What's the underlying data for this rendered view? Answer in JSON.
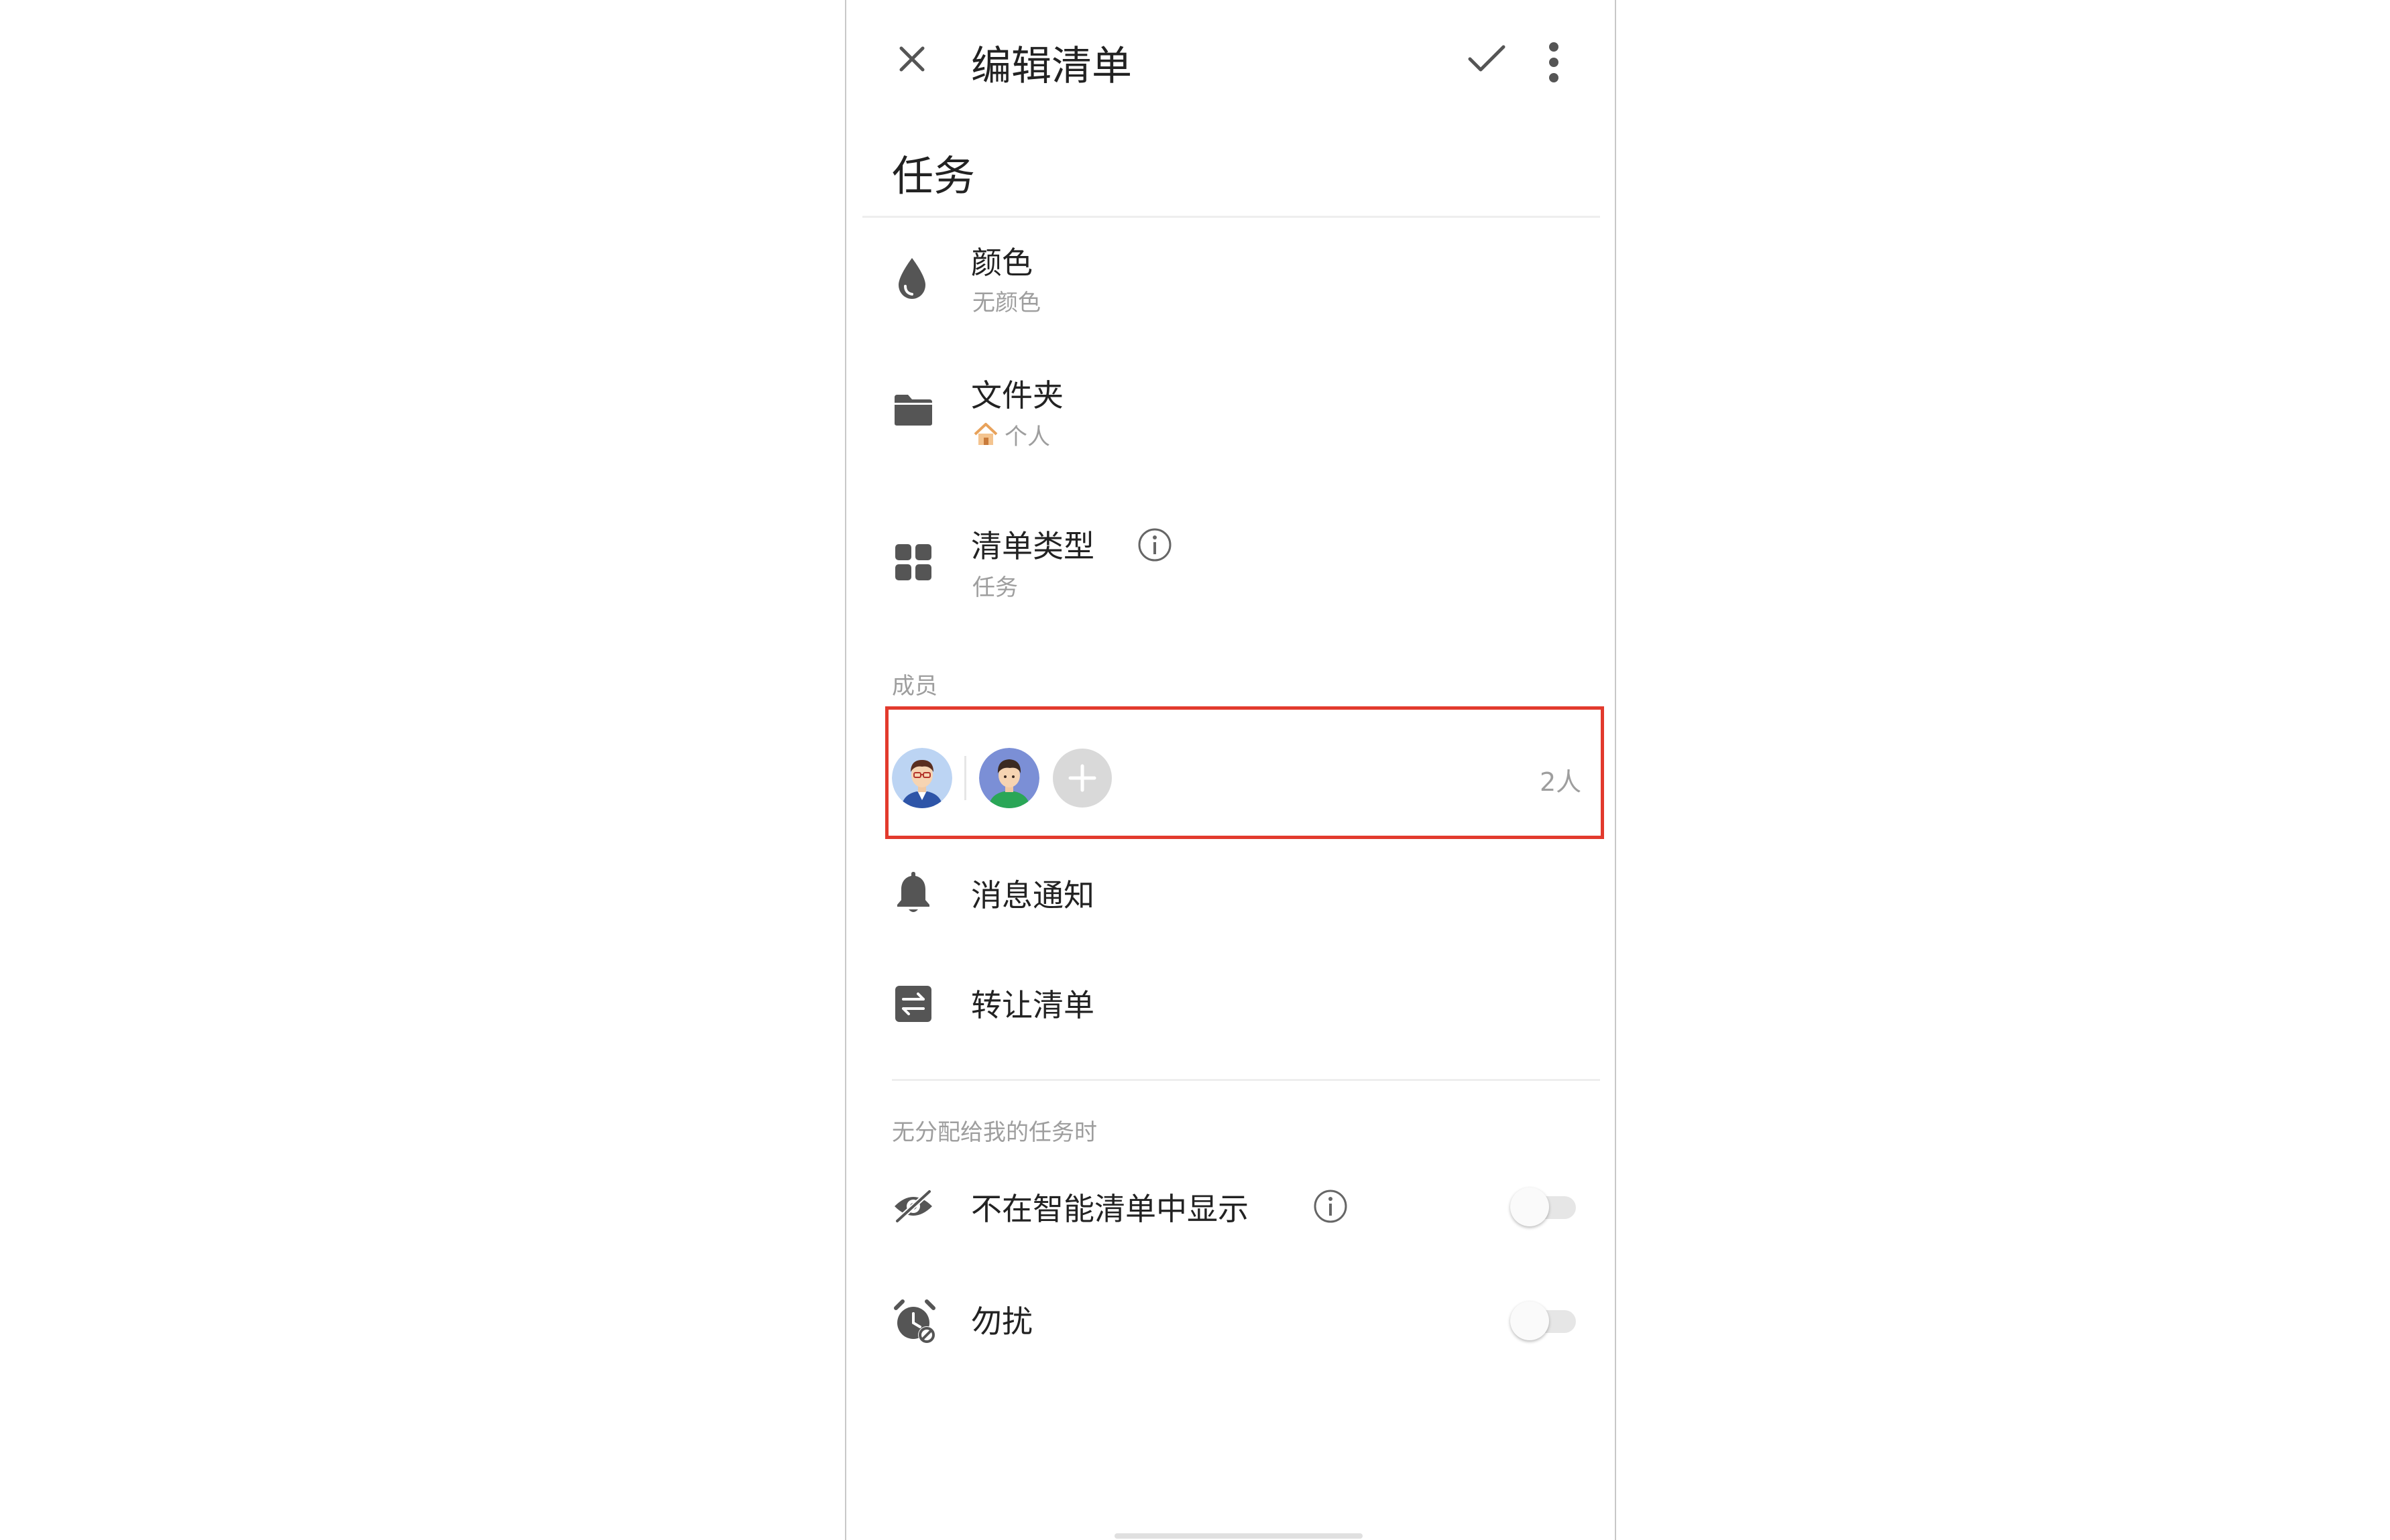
{
  "header": {
    "title": "编辑清单",
    "close_icon": "close-icon",
    "confirm_icon": "check-icon",
    "more_icon": "more-vert-icon"
  },
  "list_name": "任务",
  "settings": {
    "color": {
      "label": "颜色",
      "value": "无颜色",
      "icon": "water-drop-icon"
    },
    "folder": {
      "label": "文件夹",
      "value": "个人",
      "icon": "folder-icon",
      "value_icon": "house-emoji-icon"
    },
    "list_type": {
      "label": "清单类型",
      "value": "任务",
      "icon": "grid-icon",
      "info_icon": "info-icon"
    }
  },
  "members": {
    "section_label": "成员",
    "count_label": "2人",
    "highlight_color": "#e23a2d"
  },
  "actions": {
    "notifications": {
      "label": "消息通知",
      "icon": "bell-icon"
    },
    "transfer": {
      "label": "转让清单",
      "icon": "swap-icon"
    }
  },
  "unassigned": {
    "section_label": "无分配给我的任务时",
    "hide_smart_list": {
      "label": "不在智能清单中显示",
      "icon": "eye-off-icon",
      "enabled": false
    },
    "do_not_disturb": {
      "label": "勿扰",
      "icon": "alarm-off-icon",
      "enabled": false
    }
  }
}
